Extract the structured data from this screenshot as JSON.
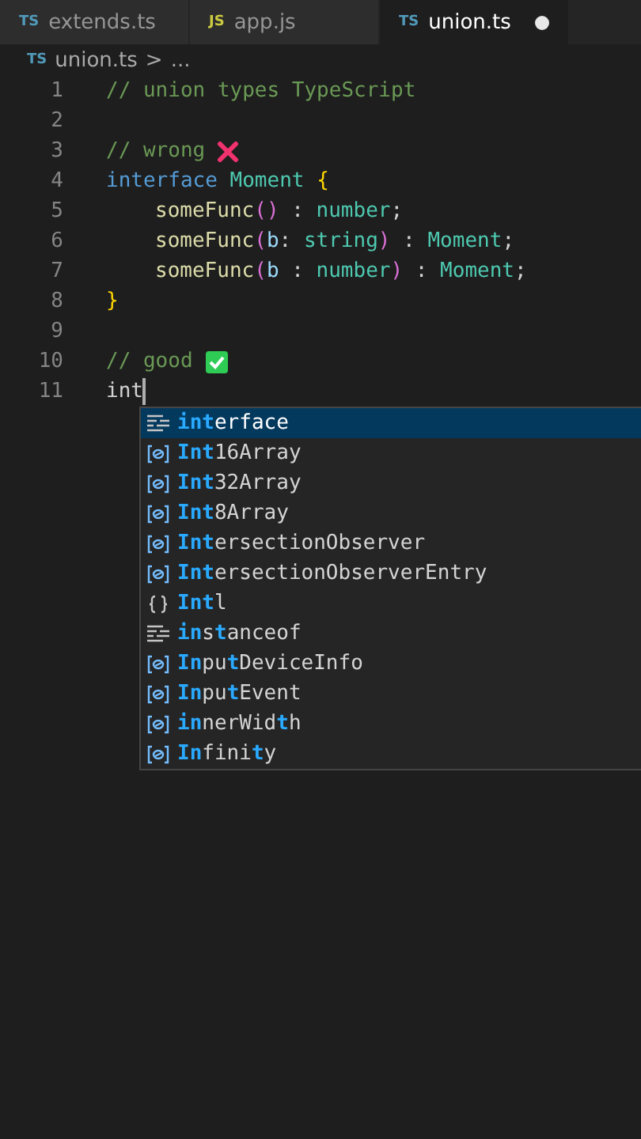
{
  "tabs": [
    {
      "badge": "TS",
      "color": "#519aba",
      "label": "extends.ts",
      "selected": false,
      "modified": false
    },
    {
      "badge": "JS",
      "color": "#cbcb41",
      "label": "app.js",
      "selected": false,
      "modified": false
    },
    {
      "badge": "TS",
      "color": "#519aba",
      "label": "union.ts",
      "selected": true,
      "modified": true
    }
  ],
  "breadcrumb": {
    "badge": "TS",
    "file": "union.ts",
    "separator": ">",
    "rest": "..."
  },
  "lines": [
    {
      "number": "1",
      "tokens": [
        {
          "kind": "comment",
          "text": "// union types TypeScript"
        }
      ]
    },
    {
      "number": "2"
    },
    {
      "number": "3",
      "tokens": [
        {
          "kind": "comment",
          "text": "// wrong "
        },
        {
          "kind": "cross"
        }
      ]
    },
    {
      "number": "4",
      "tokens": [
        {
          "kind": "keyword",
          "text": "interface "
        },
        {
          "kind": "type",
          "text": "Moment "
        },
        {
          "kind": "brace",
          "text": "{"
        }
      ],
      "children": [
        {
          "number": "5",
          "tokens": [
            {
              "kind": "func",
              "text": "someFunc"
            },
            {
              "kind": "paren",
              "text": "()"
            },
            {
              "kind": "plain",
              "text": " : "
            },
            {
              "kind": "type",
              "text": "number"
            },
            {
              "kind": "plain",
              "text": ";"
            }
          ]
        },
        {
          "number": "6",
          "tokens": [
            {
              "kind": "func",
              "text": "someFunc"
            },
            {
              "kind": "paren",
              "text": "("
            },
            {
              "kind": "param",
              "text": "b"
            },
            {
              "kind": "plain",
              "text": ": "
            },
            {
              "kind": "type",
              "text": "string"
            },
            {
              "kind": "paren",
              "text": ")"
            },
            {
              "kind": "plain",
              "text": " : "
            },
            {
              "kind": "type",
              "text": "Moment"
            },
            {
              "kind": "plain",
              "text": ";"
            }
          ]
        },
        {
          "number": "7",
          "tokens": [
            {
              "kind": "func",
              "text": "someFunc"
            },
            {
              "kind": "paren",
              "text": "("
            },
            {
              "kind": "param",
              "text": "b"
            },
            {
              "kind": "plain",
              "text": " : "
            },
            {
              "kind": "type",
              "text": "number"
            },
            {
              "kind": "paren",
              "text": ")"
            },
            {
              "kind": "plain",
              "text": " : "
            },
            {
              "kind": "type",
              "text": "Moment"
            },
            {
              "kind": "plain",
              "text": ";"
            }
          ]
        }
      ]
    },
    {
      "number": "8",
      "tokens": [
        {
          "kind": "brace",
          "text": "}"
        }
      ]
    },
    {
      "number": "9"
    },
    {
      "number": "10",
      "tokens": [
        {
          "kind": "comment",
          "text": "// good "
        },
        {
          "kind": "check"
        }
      ]
    },
    {
      "number": "11",
      "tokens": [
        {
          "kind": "plain",
          "text": "int"
        }
      ],
      "cursor": true
    }
  ],
  "suggestions": [
    {
      "kind": "keyword",
      "selected": true,
      "parts": [
        {
          "text": "int",
          "matched": true
        },
        {
          "text": "erface",
          "matched": false
        }
      ]
    },
    {
      "kind": "variable",
      "selected": false,
      "parts": [
        {
          "text": "Int",
          "matched": true
        },
        {
          "text": "16Array",
          "matched": false
        }
      ]
    },
    {
      "kind": "variable",
      "selected": false,
      "parts": [
        {
          "text": "Int",
          "matched": true
        },
        {
          "text": "32Array",
          "matched": false
        }
      ]
    },
    {
      "kind": "variable",
      "selected": false,
      "parts": [
        {
          "text": "Int",
          "matched": true
        },
        {
          "text": "8Array",
          "matched": false
        }
      ]
    },
    {
      "kind": "variable",
      "selected": false,
      "parts": [
        {
          "text": "Int",
          "matched": true
        },
        {
          "text": "ersectionObserver",
          "matched": false
        }
      ]
    },
    {
      "kind": "variable",
      "selected": false,
      "parts": [
        {
          "text": "Int",
          "matched": true
        },
        {
          "text": "ersectionObserverEntry",
          "matched": false
        }
      ]
    },
    {
      "kind": "module",
      "selected": false,
      "parts": [
        {
          "text": "Int",
          "matched": true
        },
        {
          "text": "l",
          "matched": false
        }
      ]
    },
    {
      "kind": "keyword",
      "selected": false,
      "parts": [
        {
          "text": "in",
          "matched": true
        },
        {
          "text": "s",
          "matched": false
        },
        {
          "text": "t",
          "matched": true
        },
        {
          "text": "anceof",
          "matched": false
        }
      ]
    },
    {
      "kind": "variable",
      "selected": false,
      "parts": [
        {
          "text": "In",
          "matched": true
        },
        {
          "text": "pu",
          "matched": false
        },
        {
          "text": "t",
          "matched": true
        },
        {
          "text": "DeviceInfo",
          "matched": false
        }
      ]
    },
    {
      "kind": "variable",
      "selected": false,
      "parts": [
        {
          "text": "In",
          "matched": true
        },
        {
          "text": "pu",
          "matched": false
        },
        {
          "text": "t",
          "matched": true
        },
        {
          "text": "Event",
          "matched": false
        }
      ]
    },
    {
      "kind": "variable",
      "selected": false,
      "parts": [
        {
          "text": "in",
          "matched": true
        },
        {
          "text": "nerWid",
          "matched": false
        },
        {
          "text": "t",
          "matched": true
        },
        {
          "text": "h",
          "matched": false
        }
      ]
    },
    {
      "kind": "variable",
      "selected": false,
      "parts": [
        {
          "text": "In",
          "matched": true
        },
        {
          "text": "fini",
          "matched": false
        },
        {
          "text": "t",
          "matched": true
        },
        {
          "text": "y",
          "matched": false
        }
      ]
    }
  ]
}
